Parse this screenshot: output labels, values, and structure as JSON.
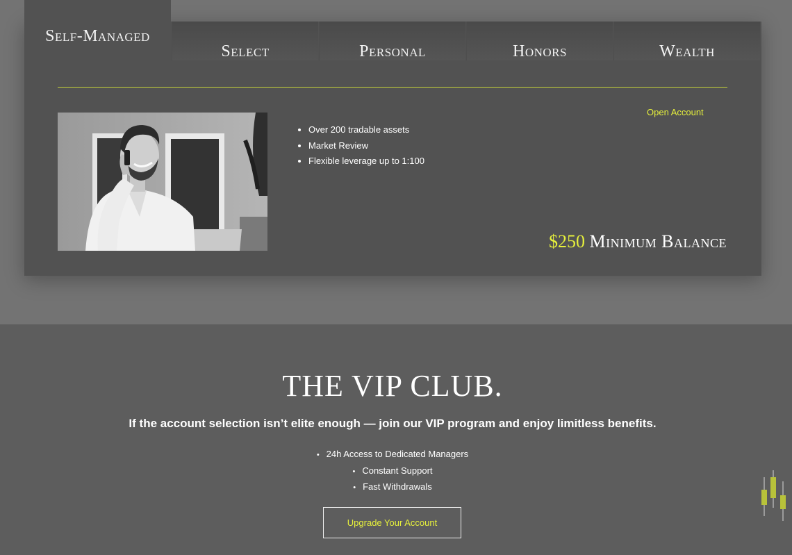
{
  "tabs": [
    {
      "label": "Self-Managed",
      "active": true
    },
    {
      "label": "Select",
      "active": false
    },
    {
      "label": "Personal",
      "active": false
    },
    {
      "label": "Honors",
      "active": false
    },
    {
      "label": "Wealth",
      "active": false
    }
  ],
  "account": {
    "features": [
      "Over 200 tradable assets",
      "Market Review",
      "Flexible leverage up to 1:100"
    ],
    "open_account_label": "Open Account",
    "min_amount": "$250",
    "min_label": "Minimum Balance",
    "photo_icon": "man-on-phone-photo"
  },
  "vip": {
    "title": "THE VIP CLUB.",
    "subtitle": "If the account selection isn’t elite enough — join our VIP program and enjoy limitless benefits.",
    "benefits": [
      "24h Access to Dedicated Managers",
      "Constant Support",
      "Fast Withdrawals"
    ],
    "button_label": "Upgrade Your Account"
  },
  "colors": {
    "accent": "#e6f03c",
    "divider": "#c7d33a",
    "card_bg": "#525252",
    "page_top_bg": "#737373",
    "page_bottom_bg": "#5d5d5d"
  },
  "widget_icon": "candlestick-chart-icon"
}
